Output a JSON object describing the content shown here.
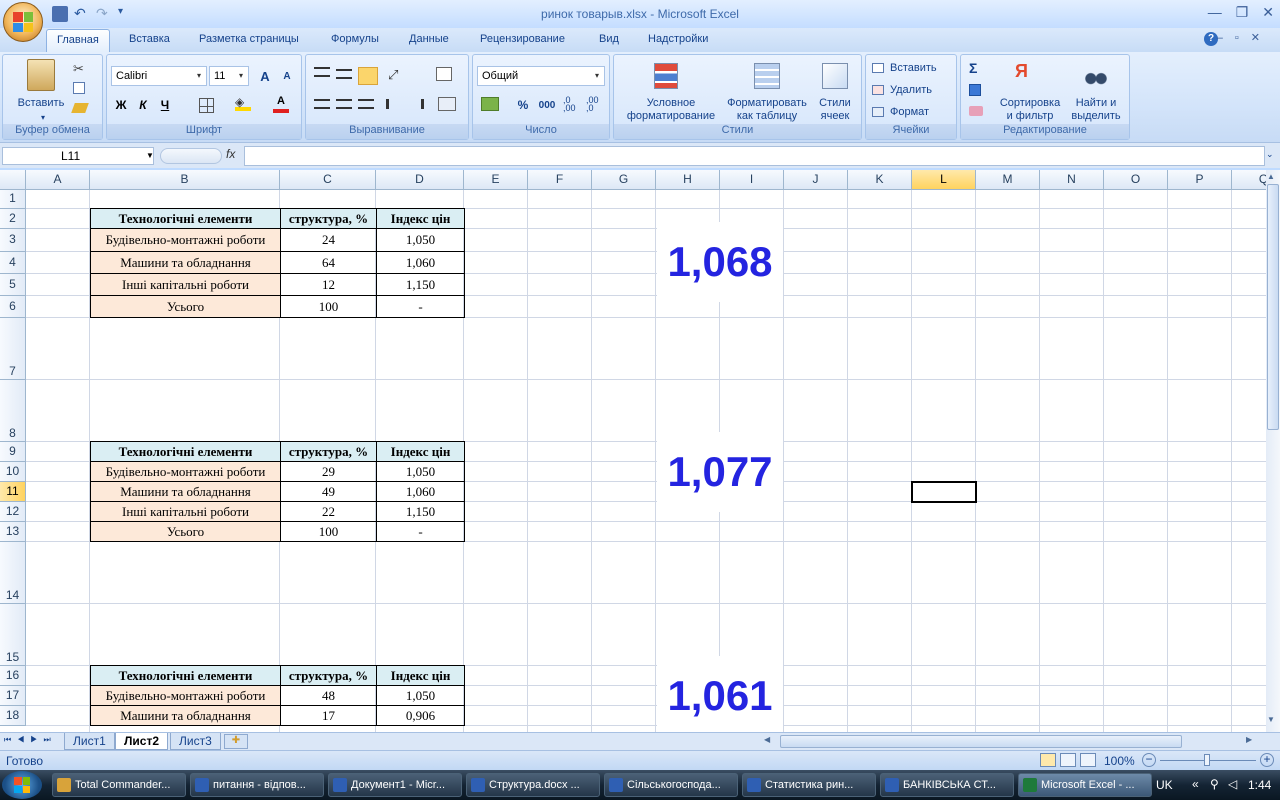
{
  "window": {
    "title": "ринок товарыв.xlsx - Microsoft Excel",
    "minimize": "—",
    "restore": "❐",
    "close": "✕"
  },
  "ribbon_tabs": [
    "Главная",
    "Вставка",
    "Разметка страницы",
    "Формулы",
    "Данные",
    "Рецензирование",
    "Вид",
    "Надстройки"
  ],
  "ribbon": {
    "clipboard": {
      "title": "Буфер обмена",
      "paste": "Вставить"
    },
    "font": {
      "title": "Шрифт",
      "name": "Calibri",
      "size": "11",
      "bold": "Ж",
      "italic": "К",
      "underline": "Ч",
      "grow": "A",
      "shrink": "A",
      "color_letter": "A"
    },
    "alignment": {
      "title": "Выравнивание"
    },
    "number": {
      "title": "Число",
      "format": "Общий",
      "percent": "%",
      "thousands": "000",
      "inc": ",0\n,00",
      "dec": ",00\n,0"
    },
    "styles": {
      "title": "Стили",
      "conditional": "Условное\nформатирование",
      "as_table": "Форматировать\nкак таблицу",
      "cell_styles": "Стили\nячеек"
    },
    "cells": {
      "title": "Ячейки",
      "insert": "Вставить",
      "delete": "Удалить",
      "format": "Формат"
    },
    "editing": {
      "title": "Редактирование",
      "sigma": "Σ",
      "sort": "Сортировка\nи фильтр",
      "find": "Найти и\nвыделить"
    }
  },
  "formula_bar": {
    "name_box": "L11",
    "fx": "fx",
    "formula": ""
  },
  "columns": [
    "A",
    "B",
    "C",
    "D",
    "E",
    "F",
    "G",
    "H",
    "I",
    "J",
    "K",
    "L",
    "M",
    "N",
    "O",
    "P",
    "Q"
  ],
  "selected_column": "L",
  "rows": [
    "1",
    "2",
    "3",
    "4",
    "5",
    "6",
    "7",
    "8",
    "9",
    "10",
    "11",
    "12",
    "13",
    "14",
    "15",
    "16",
    "17",
    "18"
  ],
  "selected_row": "11",
  "tables": [
    {
      "header": [
        "Технологічні елементи",
        "структура, %",
        "Індекс цін"
      ],
      "rows": [
        [
          "Будівельно-монтажні роботи",
          "24",
          "1,050"
        ],
        [
          "Машини та обладнання",
          "64",
          "1,060"
        ],
        [
          "Інші капітальні роботи",
          "12",
          "1,150"
        ],
        [
          "Усього",
          "100",
          "-"
        ]
      ],
      "result": "1,068"
    },
    {
      "header": [
        "Технологічні елементи",
        "структура, %",
        "Індекс цін"
      ],
      "rows": [
        [
          "Будівельно-монтажні роботи",
          "29",
          "1,050"
        ],
        [
          "Машини та обладнання",
          "49",
          "1,060"
        ],
        [
          "Інші капітальні роботи",
          "22",
          "1,150"
        ],
        [
          "Усього",
          "100",
          "-"
        ]
      ],
      "result": "1,077"
    },
    {
      "header": [
        "Технологічні елементи",
        "структура, %",
        "Індекс цін"
      ],
      "rows": [
        [
          "Будівельно-монтажні роботи",
          "48",
          "1,050"
        ],
        [
          "Машини та обладнання",
          "17",
          "0,906"
        ]
      ],
      "result": "1,061"
    }
  ],
  "sheet_tabs": [
    "Лист1",
    "Лист2",
    "Лист3"
  ],
  "active_sheet": "Лист2",
  "status": {
    "ready": "Готово",
    "zoom": "100%"
  },
  "taskbar": {
    "items": [
      {
        "label": "Total Commander...",
        "color": "#d8a33a"
      },
      {
        "label": "питання - відпов...",
        "color": "#2f5fb3"
      },
      {
        "label": "Документ1 - Micr...",
        "color": "#2f5fb3"
      },
      {
        "label": "Структура.docx ...",
        "color": "#2f5fb3"
      },
      {
        "label": "Сільськогоспода...",
        "color": "#2f5fb3"
      },
      {
        "label": "Статистика рин...",
        "color": "#2f5fb3"
      },
      {
        "label": "БАНКІВСЬКА СТ...",
        "color": "#2f5fb3"
      },
      {
        "label": "Microsoft Excel - ...",
        "color": "#1e7a3a"
      }
    ],
    "lang": "UK",
    "time": "1:44"
  },
  "colors": {
    "result_text": "#2424e0",
    "header_fill": "#daeef3",
    "label_fill": "#fde9d9"
  }
}
